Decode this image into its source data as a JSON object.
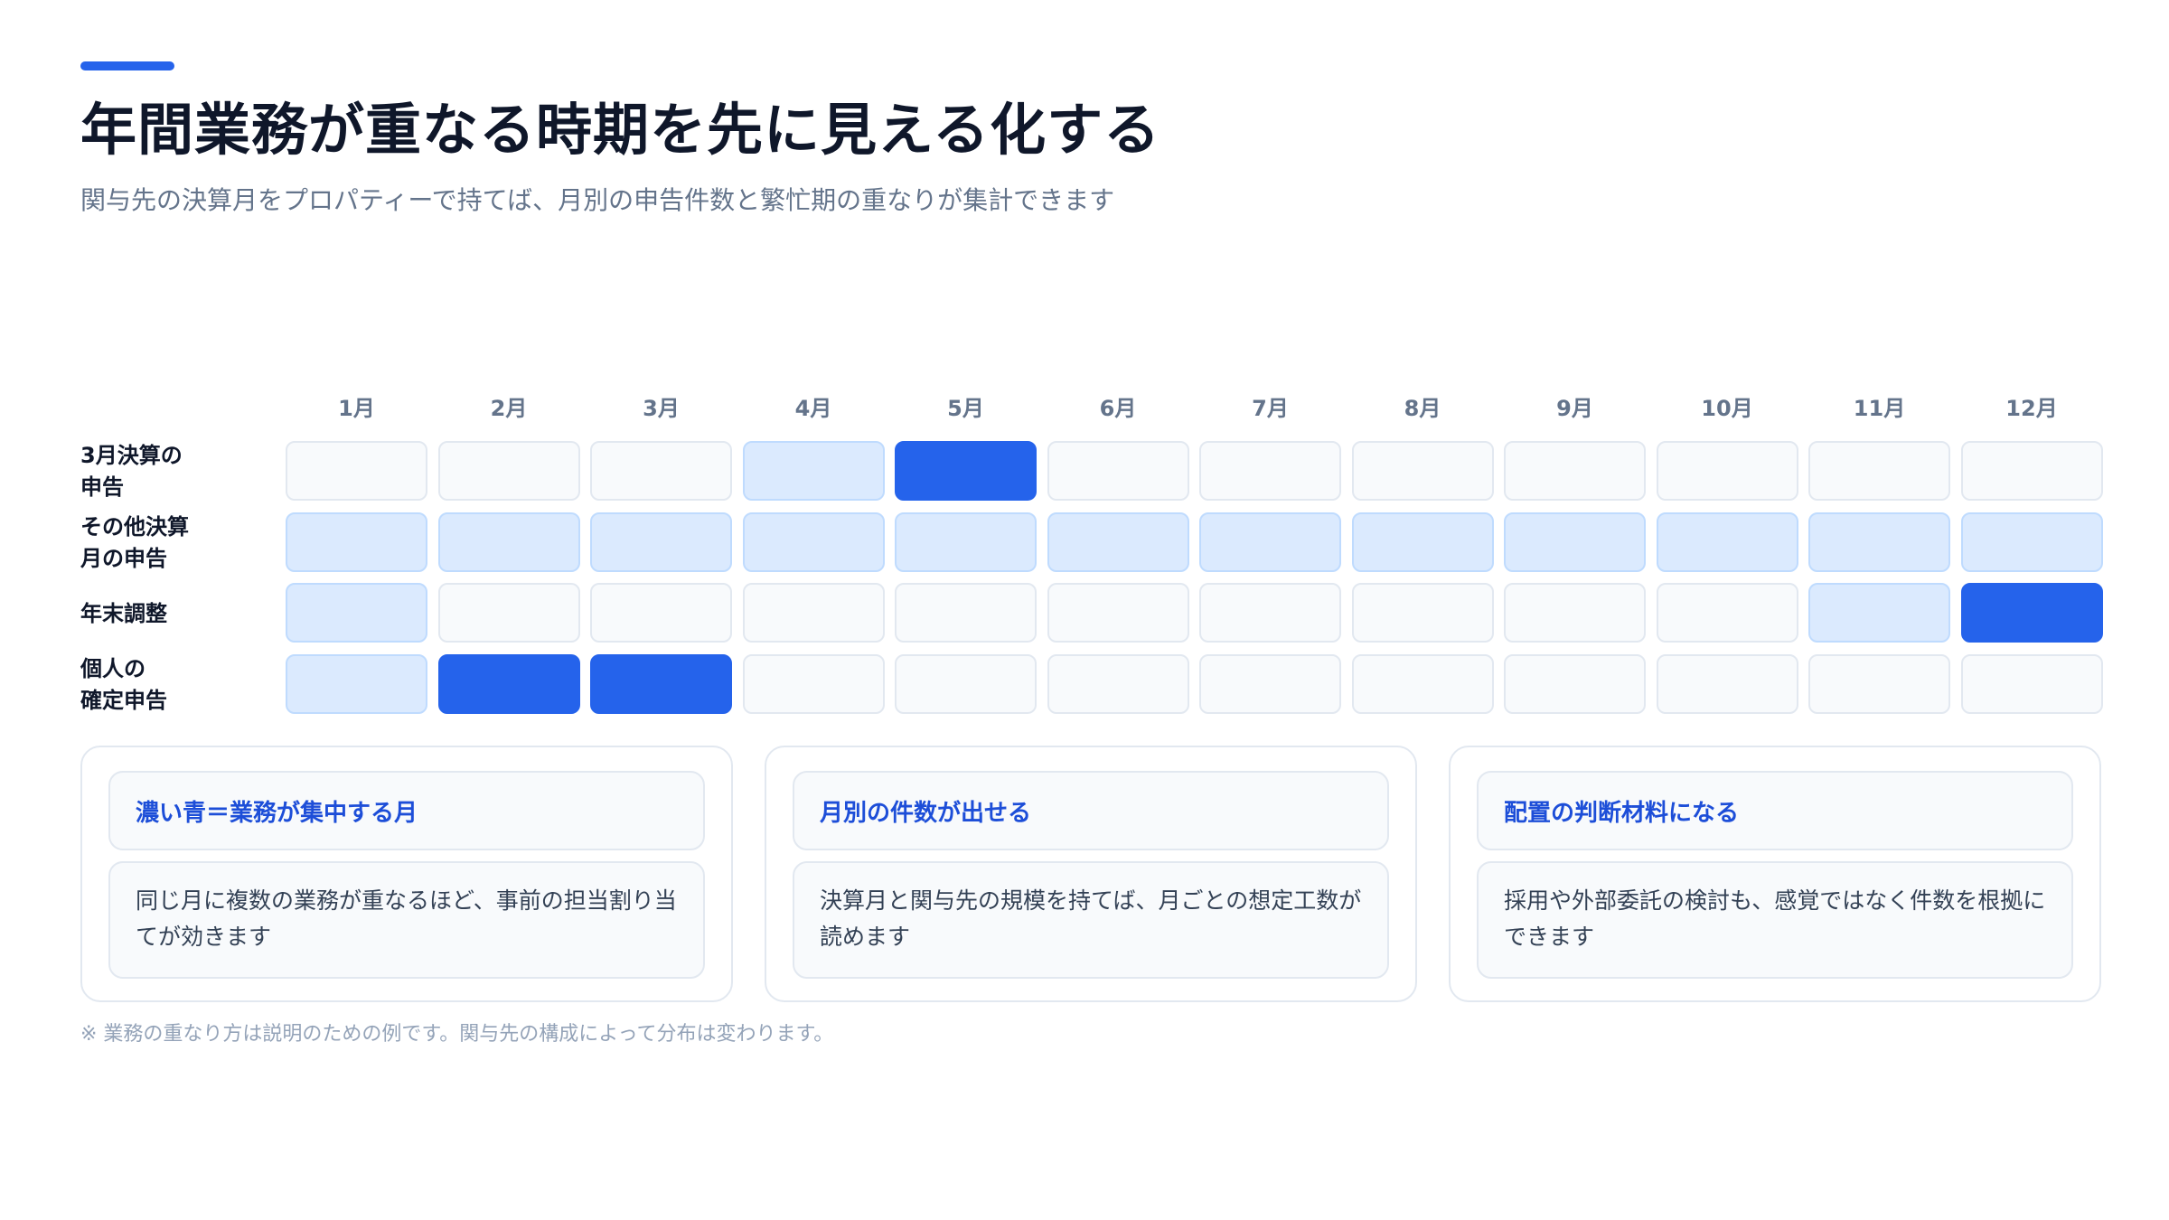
{
  "header": {
    "title": "年間業務が重なる時期を先に見える化する",
    "subtitle": "関与先の決算月をプロパティーで持てば、月別の申告件数と繁忙期の重なりが集計できます"
  },
  "heatmap": {
    "months": [
      "1月",
      "2月",
      "3月",
      "4月",
      "5月",
      "6月",
      "7月",
      "8月",
      "9月",
      "10月",
      "11月",
      "12月"
    ],
    "rows": [
      {
        "label_lines": [
          "3月決算の",
          "申告"
        ],
        "levels": [
          0,
          0,
          0,
          1,
          2,
          0,
          0,
          0,
          0,
          0,
          0,
          0
        ]
      },
      {
        "label_lines": [
          "その他決算",
          "月の申告"
        ],
        "levels": [
          1,
          1,
          1,
          1,
          1,
          1,
          1,
          1,
          1,
          1,
          1,
          1
        ]
      },
      {
        "label_lines": [
          "年末調整"
        ],
        "levels": [
          1,
          0,
          0,
          0,
          0,
          0,
          0,
          0,
          0,
          0,
          1,
          2
        ]
      },
      {
        "label_lines": [
          "個人の",
          "確定申告"
        ],
        "levels": [
          1,
          2,
          2,
          0,
          0,
          0,
          0,
          0,
          0,
          0,
          0,
          0
        ]
      }
    ],
    "level_colors": {
      "0": "#f8fafc",
      "1": "#dbeafe",
      "2": "#2563eb"
    }
  },
  "cards": [
    {
      "heading": "濃い青＝業務が集中する月",
      "body": "同じ月に複数の業務が重なるほど、事前の担当割り当てが効きます"
    },
    {
      "heading": "月別の件数が出せる",
      "body": "決算月と関与先の規模を持てば、月ごとの想定工数が読めます"
    },
    {
      "heading": "配置の判断材料になる",
      "body": "採用や外部委託の検討も、感覚ではなく件数を根拠にできます"
    }
  ],
  "footnote": "※ 業務の重なり方は説明のための例です。関与先の構成によって分布は変わります。",
  "colors": {
    "accent": "#2563eb",
    "heading_blue": "#1d4ed8",
    "light_blue": "#dbeafe"
  }
}
